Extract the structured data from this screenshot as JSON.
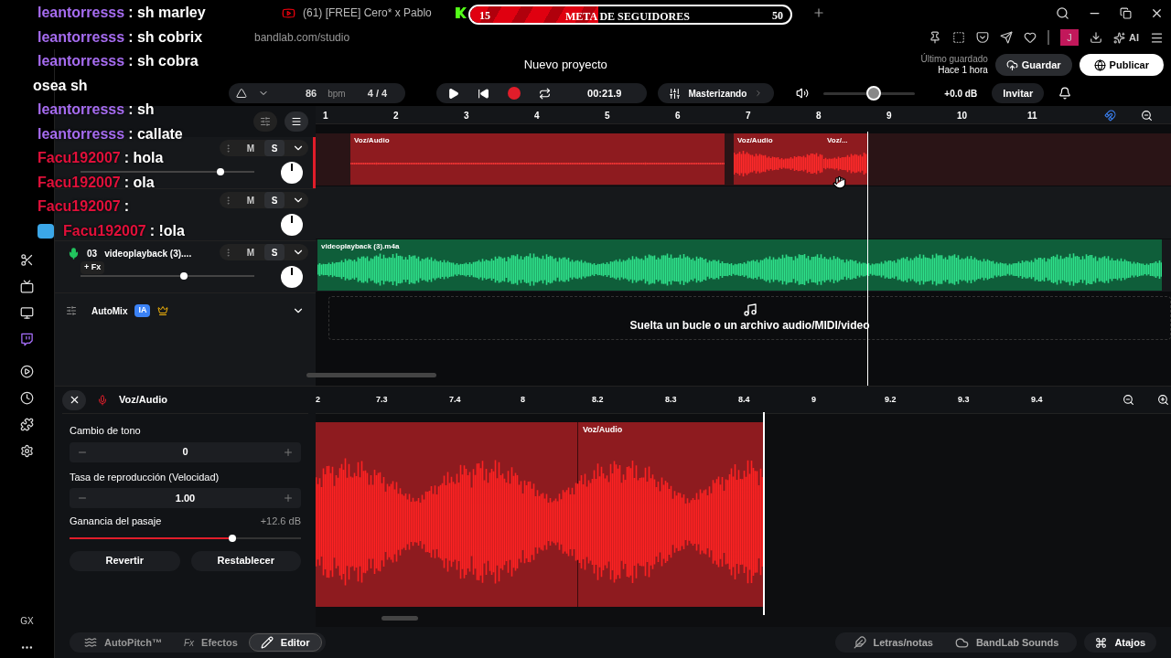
{
  "browser": {
    "tabs": [
      {
        "title": "(61) [FREE] Cero* x Pablo",
        "kind": "youtube",
        "selected": false
      },
      {
        "kind": "kick",
        "selected": false
      }
    ],
    "url": "bandlab.com/studio",
    "avatar": "J",
    "ai_label": "AI"
  },
  "goal_overlay": {
    "current": "15",
    "label": "META DE SEGUIDORES",
    "target": "50",
    "level": 0.4
  },
  "chat": [
    {
      "user": "leantorresss",
      "message": ": sh marley",
      "color": "#a66cf0"
    },
    {
      "user": "leantorresss",
      "message": ": sh cobrix",
      "color": "#a66cf0"
    },
    {
      "user": "leantorresss",
      "message": ": sh cobra",
      "color": "#a66cf0"
    },
    {
      "message": "osea sh"
    },
    {
      "user": "leantorresss",
      "message": ": sh",
      "color": "#a66cf0"
    },
    {
      "user": "leantorresss",
      "message": ": callate",
      "color": "#a66cf0"
    },
    {
      "user": "Facu192007",
      "message": ": hola",
      "color": "#e0103a"
    },
    {
      "user": "Facu192007",
      "message": ": ola",
      "color": "#e0103a"
    },
    {
      "user": "Facu192007",
      "message": ":",
      "color": "#e0103a"
    },
    {
      "user": "Facu192007",
      "message": ": !ola",
      "color": "#e0103a",
      "badge": true
    }
  ],
  "header": {
    "title": "Nuevo proyecto",
    "last_saved_label": "Último guardado",
    "last_saved": "Hace 1 hora",
    "save": "Guardar",
    "publish": "Publicar"
  },
  "transport": {
    "bpm": "86",
    "bpm_unit": "bpm",
    "time_signature": "4 / 4",
    "recording": true,
    "time": "00:21.9",
    "mastering": "Masterizando",
    "volume": {
      "level": 0.55
    },
    "gain": "+0.0 dB",
    "invite": "Invitar"
  },
  "tracks": [
    {
      "mute": "M",
      "solo": "S",
      "color": "#e11d2a",
      "selected": true,
      "level": 0.82,
      "clips": [
        {
          "label": "Voz/Audio",
          "kind": "flat"
        },
        {
          "label": "Voz/Audio",
          "kind": "wave"
        },
        {
          "label": "Voz/...",
          "kind": "wave"
        }
      ]
    },
    {
      "mute": "M",
      "solo": "S",
      "selected": false
    },
    {
      "number": "03",
      "name": "videoplayback (3)....",
      "fx": "+ Fx",
      "mute": "M",
      "solo": "S",
      "color": "#22c55e",
      "selected": false,
      "level": 0.6,
      "clips": [
        {
          "label": "videoplayback (3).m4a",
          "kind": "wave"
        }
      ]
    }
  ],
  "automix": {
    "label": "AutoMix",
    "badge": "IA"
  },
  "ruler": [
    "1",
    "2",
    "3",
    "4",
    "5",
    "6",
    "7",
    "8",
    "9",
    "10",
    "11"
  ],
  "drop_zone": "Suelta un bucle o un archivo audio/MIDI/video",
  "editor": {
    "track": "Voz/Audio",
    "pitch_label": "Cambio de tono",
    "pitch": "0",
    "rate_label": "Tasa de reproducción (Velocidad)",
    "rate": "1.00",
    "gain_label": "Ganancia del pasaje",
    "gain": "+12.6 dB",
    "gain_slider": {
      "level": 0.71
    },
    "revert": "Revertir",
    "reset": "Restablecer",
    "ruler": [
      "2",
      "7.3",
      "7.4",
      "8",
      "8.2",
      "8.3",
      "8.4",
      "9",
      "9.2",
      "9.3",
      "9.4"
    ],
    "clip": "Voz/Audio"
  },
  "sidebar_label": "GX",
  "bottom_left": [
    {
      "label": "AutoPitch™",
      "kind": "pitch",
      "selected": false
    },
    {
      "label": "Efectos",
      "kind": "fx",
      "prefix": "Fx",
      "selected": false
    },
    {
      "label": "Editor",
      "kind": "pencil",
      "selected": true
    }
  ],
  "bottom_right": [
    {
      "label": "Letras/notas",
      "kind": "feather"
    },
    {
      "label": "BandLab Sounds",
      "kind": "sounds"
    }
  ],
  "shortcuts": "Atajos"
}
